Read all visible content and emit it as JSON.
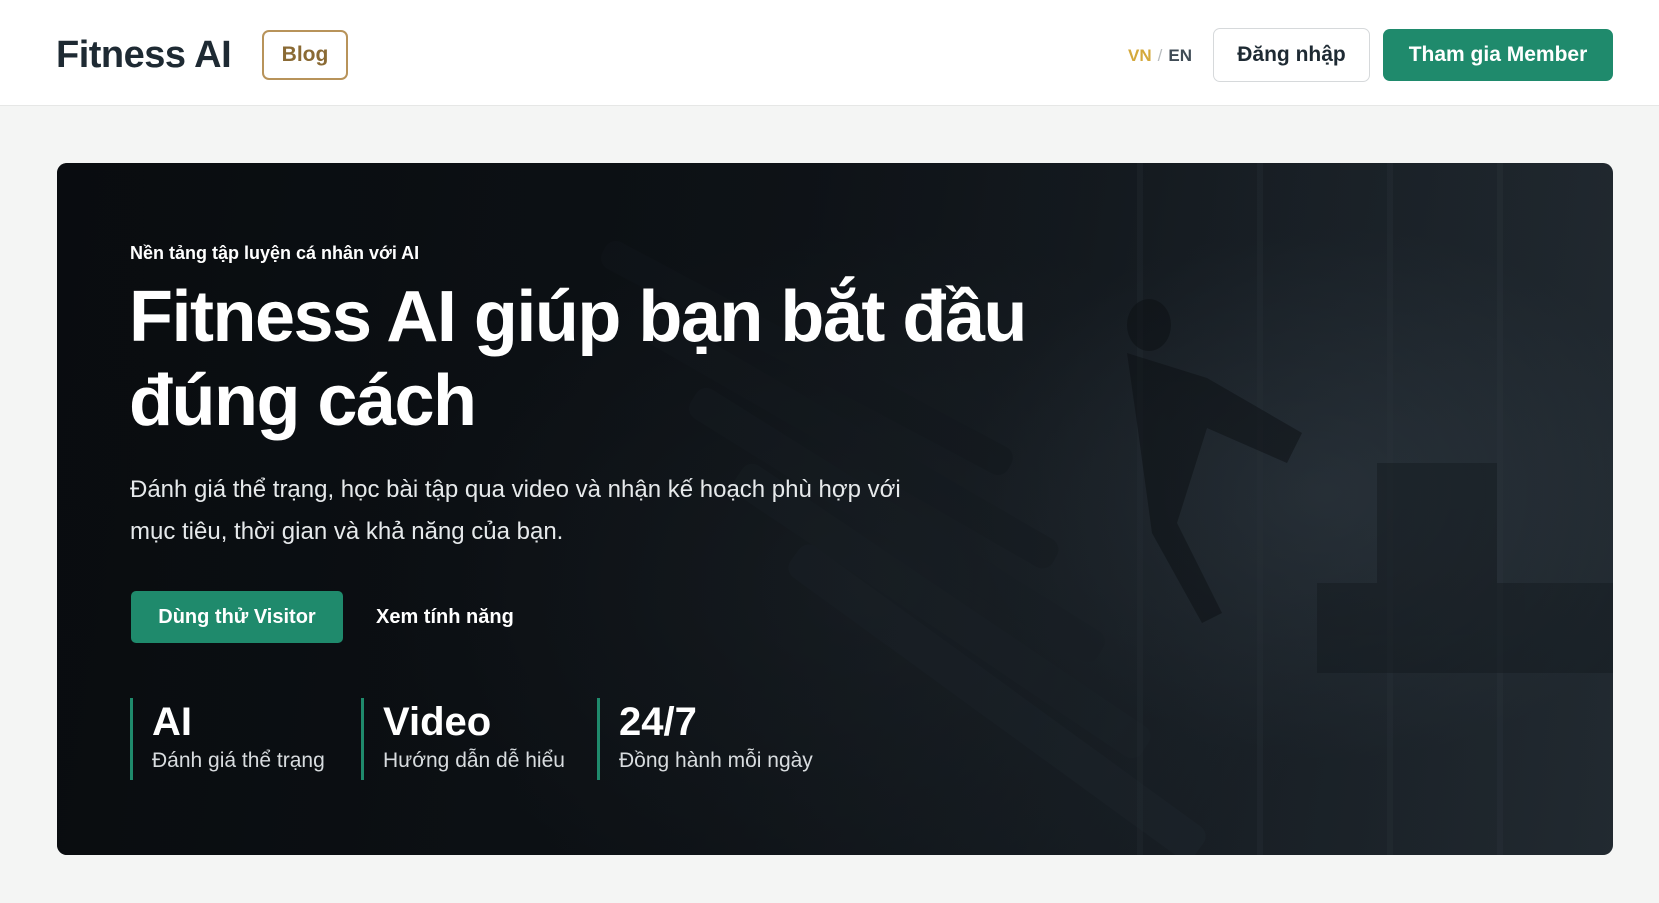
{
  "header": {
    "brand": "Fitness AI",
    "blog_label": "Blog",
    "lang_vn": "VN",
    "lang_sep": "/",
    "lang_en": "EN",
    "login_label": "Đăng nhập",
    "member_label": "Tham gia Member"
  },
  "hero": {
    "eyebrow": "Nền tảng tập luyện cá nhân với AI",
    "headline_line1": "Fitness AI giúp bạn bắt đầu",
    "headline_line2": "đúng cách",
    "subtext_line1": "Đánh giá thể trạng, học bài tập qua video và nhận kế hoạch phù hợp với",
    "subtext_line2": "mục tiêu, thời gian và khả năng của bạn.",
    "cta_primary": "Dùng thử Visitor",
    "cta_secondary": "Xem tính năng",
    "stats": [
      {
        "value": "AI",
        "label": "Đánh giá thể trạng"
      },
      {
        "value": "Video",
        "label": "Hướng dẫn dễ hiểu"
      },
      {
        "value": "24/7",
        "label": "Đồng hành mỗi ngày"
      }
    ]
  },
  "colors": {
    "brand_green": "#1f8a6c",
    "blog_gold": "#b8935a",
    "lang_active": "#d4a93c",
    "text_dark": "#1e2a33"
  }
}
